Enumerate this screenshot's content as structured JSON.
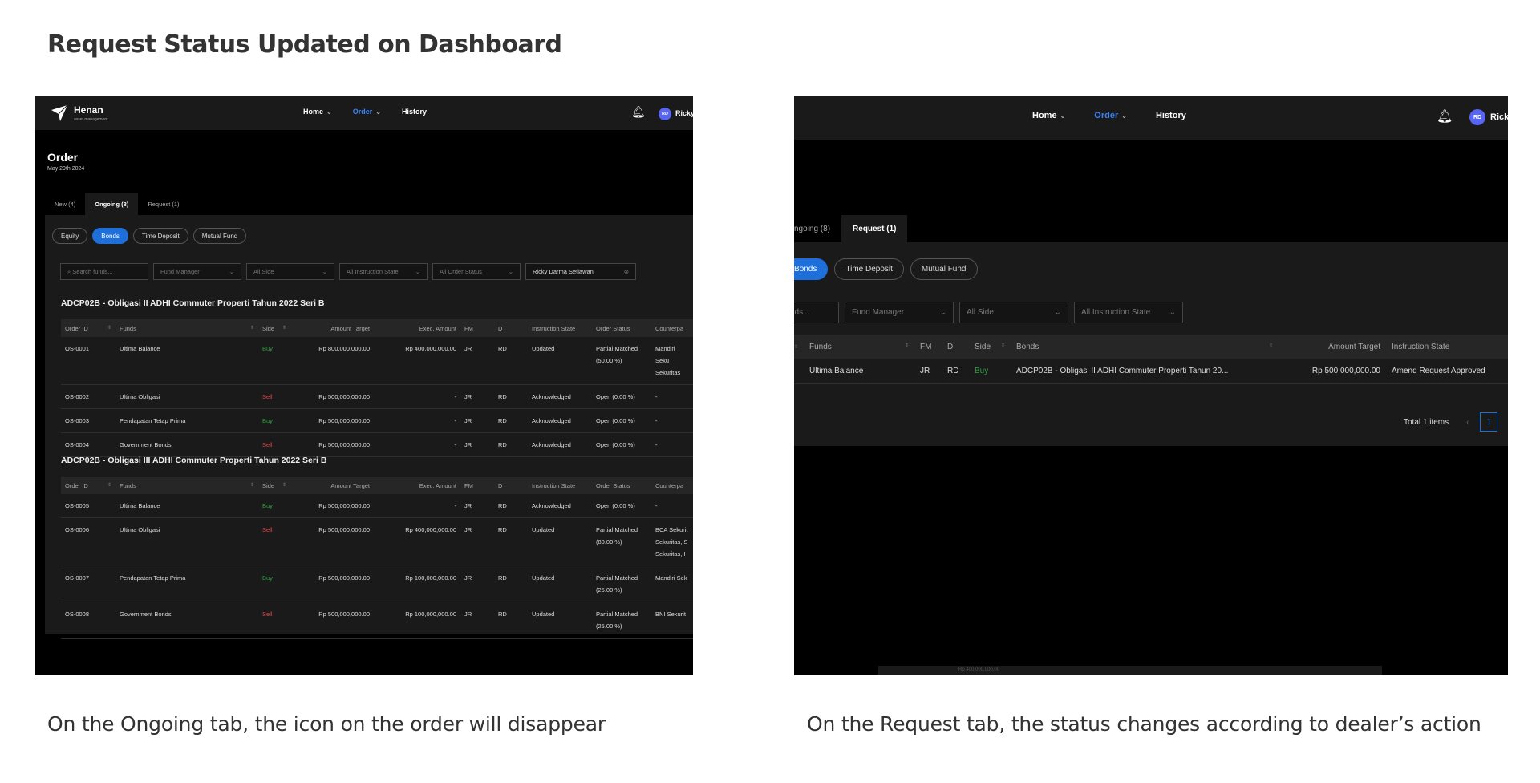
{
  "page_title": "Request Status Updated on Dashboard",
  "captions": {
    "left": "On the Ongoing tab, the icon on the order will disappear",
    "right": "On the Request tab, the status changes according to dealer’s action"
  },
  "nav": {
    "logo": "Henan",
    "logo_sub": "asset management",
    "home": "Home",
    "order": "Order",
    "history": "History",
    "avatar": "RD",
    "user": "Ricky",
    "user_b": "Rick"
  },
  "order_page": {
    "title": "Order",
    "date": "May 29th 2024",
    "tabs": [
      "New (4)",
      "Ongoing (8)",
      "Request (1)"
    ],
    "chips": [
      "Equity",
      "Bonds",
      "Time Deposit",
      "Mutual Fund"
    ],
    "filters": {
      "search_placeholder": "Search funds...",
      "fund_manager": "Fund Manager",
      "side": "All Side",
      "instruction_state": "All Instruction State",
      "order_status": "All Order Status",
      "dealer": "Ricky Darma Setiawan"
    },
    "columns": [
      "Order ID",
      "Funds",
      "Side",
      "Amount Target",
      "Exec. Amount",
      "FM",
      "D",
      "Instruction State",
      "Order Status",
      "Counterpa"
    ],
    "groups": [
      {
        "title": "ADCP02B - Obligasi II ADHI Commuter Properti Tahun 2022 Seri B",
        "rows": [
          {
            "id": "OS-0001",
            "fund": "Ultima Balance",
            "side": "Buy",
            "target": "Rp 800,000,000.00",
            "exec": "Rp 400,000,000.00",
            "fm": "JR",
            "d": "RD",
            "state": "Updated",
            "status": "Partial Matched (50.00 %)",
            "cp": "Mandiri Seku Sekuritas"
          },
          {
            "id": "OS-0002",
            "fund": "Ultima Obligasi",
            "side": "Sell",
            "target": "Rp 500,000,000.00",
            "exec": "-",
            "fm": "JR",
            "d": "RD",
            "state": "Acknowledged",
            "status": "Open (0.00 %)",
            "cp": "-"
          },
          {
            "id": "OS-0003",
            "fund": "Pendapatan Tetap Prima",
            "side": "Buy",
            "target": "Rp 500,000,000.00",
            "exec": "-",
            "fm": "JR",
            "d": "RD",
            "state": "Acknowledged",
            "status": "Open (0.00 %)",
            "cp": "-"
          },
          {
            "id": "OS-0004",
            "fund": "Government Bonds",
            "side": "Sell",
            "target": "Rp 500,000,000.00",
            "exec": "-",
            "fm": "JR",
            "d": "RD",
            "state": "Acknowledged",
            "status": "Open (0.00 %)",
            "cp": "-"
          }
        ]
      },
      {
        "title": "ADCP02B - Obligasi III ADHI Commuter Properti Tahun 2022 Seri B",
        "rows": [
          {
            "id": "OS-0005",
            "fund": "Ultima Balance",
            "side": "Buy",
            "target": "Rp 500,000,000.00",
            "exec": "-",
            "fm": "JR",
            "d": "RD",
            "state": "Acknowledged",
            "status": "Open (0.00 %)",
            "cp": "-"
          },
          {
            "id": "OS-0006",
            "fund": "Ultima Obligasi",
            "side": "Sell",
            "target": "Rp 500,000,000.00",
            "exec": "Rp 400,000,000.00",
            "fm": "JR",
            "d": "RD",
            "state": "Updated",
            "status": "Partial Matched (80.00 %)",
            "cp": "BCA Sekurit Sekuritas, S Sekuritas, I"
          },
          {
            "id": "OS-0007",
            "fund": "Pendapatan Tetap Prima",
            "side": "Buy",
            "target": "Rp 500,000,000.00",
            "exec": "Rp 100,000,000.00",
            "fm": "JR",
            "d": "RD",
            "state": "Updated",
            "status": "Partial Matched (25.00 %)",
            "cp": "Mandiri Sek"
          },
          {
            "id": "OS-0008",
            "fund": "Government Bonds",
            "side": "Sell",
            "target": "Rp 500,000,000.00",
            "exec": "Rp 100,000,000.00",
            "fm": "JR",
            "d": "RD",
            "state": "Updated",
            "status": "Partial Matched (25.00 %)",
            "cp": "BNI Sekurit"
          }
        ]
      }
    ]
  },
  "request_page": {
    "tabs": [
      "ngoing (8)",
      "Request (1)"
    ],
    "chips": [
      "Bonds",
      "Time Deposit",
      "Mutual Fund"
    ],
    "filters": {
      "search_placeholder": "nds...",
      "fund_manager": "Fund Manager",
      "side": "All Side",
      "instruction_state": "All Instruction State"
    },
    "columns": [
      "Funds",
      "FM",
      "D",
      "Side",
      "Bonds",
      "Amount Target",
      "Instruction State"
    ],
    "rows": [
      {
        "fund": "Ultima Balance",
        "fm": "JR",
        "d": "RD",
        "side": "Buy",
        "bond": "ADCP02B - Obligasi II ADHI Commuter Properti Tahun 20...",
        "target": "Rp 500,000,000.00",
        "state": "Amend Request Approved"
      }
    ],
    "total": "Total 1 items",
    "prev": "‹",
    "page": "1",
    "bottom_text": "Rp 400,000,000.00"
  },
  "colors": {
    "accent": "#1e6fd9",
    "buy": "#2ea043",
    "sell": "#e5484d",
    "background": "#000000",
    "panel": "#1a1a1a"
  }
}
